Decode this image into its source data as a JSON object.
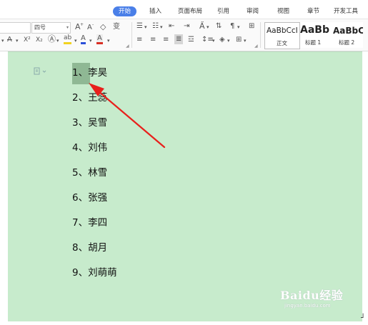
{
  "ribbon_tabs": [
    "开始",
    "插入",
    "页面布局",
    "引用",
    "审阅",
    "视图",
    "章节",
    "开发工具"
  ],
  "toolbar": {
    "font_size_value": "四号",
    "grow_font": "A",
    "shrink_font": "A",
    "clear_format": "◇",
    "phonetic": "变",
    "strike": "A",
    "superscript": "X²",
    "subscript": "X₂",
    "highlight_label": "ab",
    "font_color_label": "A",
    "char_shade_label": "A"
  },
  "styles": [
    {
      "sample": "AaBbCcI",
      "caption": "正文"
    },
    {
      "sample": "AaBb",
      "caption": "标题 1"
    },
    {
      "sample": "AaBbC",
      "caption": "标题 2"
    }
  ],
  "list": [
    {
      "num": "1、",
      "name": "李昊"
    },
    {
      "num": "2、",
      "name": "王蕊"
    },
    {
      "num": "3、",
      "name": "吴雪"
    },
    {
      "num": "4、",
      "name": "刘伟"
    },
    {
      "num": "5、",
      "name": "林雪"
    },
    {
      "num": "6、",
      "name": "张强"
    },
    {
      "num": "7、",
      "name": "李四"
    },
    {
      "num": "8、",
      "name": "胡月"
    },
    {
      "num": "9、",
      "name": "刘萌萌"
    }
  ],
  "watermark": {
    "brand": "Baidu经验",
    "sub": "jingyan.baidu.com"
  },
  "colors": {
    "accent": "#4a7fe8",
    "document_bg": "#c7ebcc",
    "selection": "#8fb894",
    "arrow": "#e8201c",
    "font_color_swatch": "#2b4fd8",
    "highlight_swatch": "#f2d320",
    "shade_swatch": "#d93025"
  }
}
